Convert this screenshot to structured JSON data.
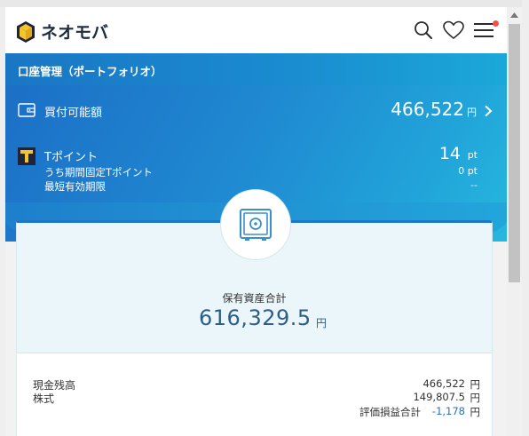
{
  "header": {
    "brand": "ネオモバ",
    "notification": true
  },
  "portfolio": {
    "title": "口座管理（ポートフォリオ）"
  },
  "buying_power": {
    "label": "買付可能額",
    "value": "466,522",
    "unit": "円"
  },
  "tpoint": {
    "label": "Tポイント",
    "value": "14",
    "unit": "pt",
    "sub1_label": "うち期間固定Tポイント",
    "sub1_value": "0 pt",
    "sub2_label": "最短有効期限",
    "sub2_value": "--"
  },
  "assets": {
    "total_label": "保有資産合計",
    "total_value": "616,329.5",
    "total_unit": "円",
    "cash_label": "現金残高",
    "cash_value": "466,522",
    "cash_unit": "円",
    "stock_label": "株式",
    "stock_value": "149,807.5",
    "stock_unit": "円",
    "pl_label": "評価損益合計",
    "pl_value": "-1,178",
    "pl_unit": "円"
  },
  "colors": {
    "brand_blue": "#1c77c8",
    "light_blue": "#26b7de",
    "negative": "#2a6fb8",
    "badge": "#f0524a"
  }
}
